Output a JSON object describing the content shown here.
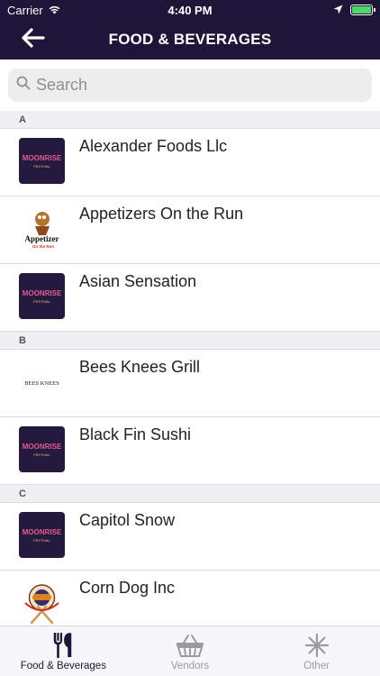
{
  "status_bar": {
    "carrier": "Carrier",
    "time": "4:40 PM"
  },
  "nav": {
    "title": "FOOD & BEVERAGES",
    "back_icon": "arrow-left-icon"
  },
  "search": {
    "placeholder": "Search",
    "value": ""
  },
  "sections": [
    {
      "header": "A",
      "items": [
        {
          "name": "Alexander Foods Llc",
          "logo": "moonrise-festival-logo"
        },
        {
          "name": "Appetizers On the Run",
          "logo": "appetizers-on-the-run-logo"
        },
        {
          "name": "Asian Sensation",
          "logo": "moonrise-festival-logo"
        }
      ]
    },
    {
      "header": "B",
      "items": [
        {
          "name": "Bees Knees Grill",
          "logo": "bees-knees-logo"
        },
        {
          "name": "Black Fin Sushi",
          "logo": "moonrise-festival-logo"
        }
      ]
    },
    {
      "header": "C",
      "items": [
        {
          "name": "Capitol Snow",
          "logo": "moonrise-festival-logo"
        },
        {
          "name": "Corn Dog Inc",
          "logo": "corn-dog-logo"
        }
      ]
    }
  ],
  "logo_text": {
    "moonrise_line1": "MOONRISE",
    "moonrise_line2": "FESTIVAL",
    "appetizers_line1": "Appetizer",
    "appetizers_line2": "On the Run",
    "bees_knees": "BEES KNEES"
  },
  "tabs": [
    {
      "label": "Food & Beverages",
      "icon": "fork-knife-icon",
      "active": true
    },
    {
      "label": "Vendors",
      "icon": "basket-icon",
      "active": false
    },
    {
      "label": "Other",
      "icon": "asterisk-icon",
      "active": false
    }
  ],
  "colors": {
    "nav_bg": "#1f1538",
    "active_tab": "#1f1538",
    "inactive_tab": "#9a9aa0",
    "battery": "#4cd964"
  }
}
